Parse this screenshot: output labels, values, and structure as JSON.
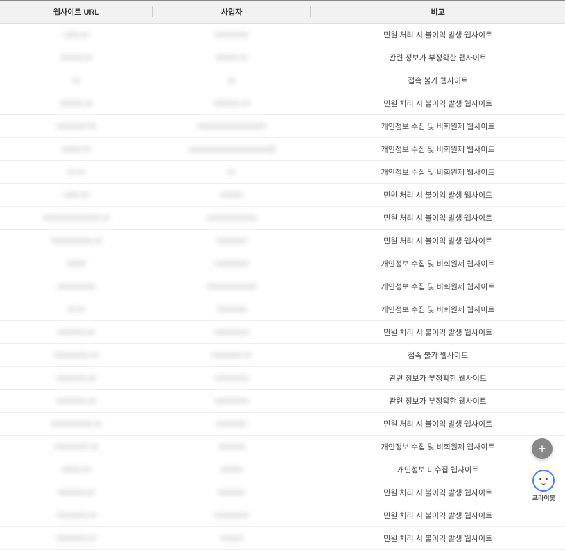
{
  "table": {
    "headers": {
      "url": "웹사이트 URL",
      "operator": "사업자",
      "remark": "비고"
    },
    "rows": [
      {
        "url": "xxxx.xx",
        "operator": "xxxxxxxxx",
        "remark": "민원 처리 시 불이익 발생 웹사이트"
      },
      {
        "url": "xxxxxx.xx",
        "operator": "xxxxxx.xx",
        "remark": "관련 정보가 부정확한 웹사이트"
      },
      {
        "url": "xx",
        "operator": "xx",
        "remark": "접속 불가 웹사이트"
      },
      {
        "url": "xxxxxx.xx",
        "operator": "xxxxxxx.xx",
        "remark": "민원 처리 시 불이익 발생 웹사이트"
      },
      {
        "url": "xxxxxxxx.xx",
        "operator": "xxxxxxxxxxxxxxxxxx",
        "remark": "개인정보 수집 및 비회원제 웹사이트"
      },
      {
        "url": "xxxxx.xx",
        "operator": "xxxxxxxxxxxxxxxxxxxxx관",
        "remark": "개인정보 수집 및 비회원제 웹사이트"
      },
      {
        "url": "xx.xx",
        "operator": "xx",
        "remark": "개인정보 수집 및 비회원제 웹사이트"
      },
      {
        "url": "xxxx.xx",
        "operator": "xxxxxx",
        "remark": "민원 처리 시 불이익 발생 웹사이트"
      },
      {
        "url": "xxxxxxxxxxxxxxx.xx",
        "operator": "xxxxxxxxxxxxx",
        "remark": "민원 처리 시 불이익 발생 웹사이트"
      },
      {
        "url": "xxxxxxxxxxx.xx",
        "operator": "xxxxxxxx",
        "remark": "민원 처리 시 불이익 발생 웹사이트"
      },
      {
        "url": "xxxxx",
        "operator": "xxxxxxxxx",
        "remark": "개인정보 수집 및 비회원제 웹사이트"
      },
      {
        "url": "xxxxxxxxxx",
        "operator": "xxxxxxxxxxxxx",
        "remark": "개인정보 수집 및 비회원제 웹사이트"
      },
      {
        "url": "xx.xx",
        "operator": "xxxxxxxx",
        "remark": "개인정보 수집 및 비회원제 웹사이트"
      },
      {
        "url": "xxxxxxx.xx",
        "operator": "xxxxxxxxx",
        "remark": "민원 처리 시 불이익 발생 웹사이트"
      },
      {
        "url": "xxxxxxxxx.xx",
        "operator": "xxxxxxxx.xx",
        "remark": "접속 불가 웹사이트"
      },
      {
        "url": "xxxxxxxx.xx",
        "operator": "xxxxxxxxx",
        "remark": "관련 정보가 부정확한 웹사이트"
      },
      {
        "url": "xxxxxxxx.xx",
        "operator": "xxxxxxxxx",
        "remark": "관련 정보가 부정확한 웹사이트"
      },
      {
        "url": "xxxxxxxxxxx.xx",
        "operator": "xxxxxxxx",
        "remark": "민원 처리 시 불이익 발생 웹사이트"
      },
      {
        "url": "xxxxxxxxx.xx",
        "operator": "xxxxxxx",
        "remark": "개인정보 수집 및 비회원제 웹사이트"
      },
      {
        "url": "xxxxx.xx",
        "operator": "xxxxxx",
        "remark": "개인정보 미수집 웹사이트"
      },
      {
        "url": "xxxxxxx.xx",
        "operator": "xxxxxxx",
        "remark": "민원 처리 시 불이익 발생 웹사이트"
      },
      {
        "url": "xxxxxxxx.xx",
        "operator": "xxxxxxxxx",
        "remark": "민원 처리 시 불이익 발생 웹사이트"
      },
      {
        "url": "xxxxxxxx.xx",
        "operator": "xxxxxx",
        "remark": "민원 처리 시 불이익 발생 웹사이트"
      }
    ]
  },
  "chat": {
    "label": "프라이봇"
  },
  "fab": {
    "label": "+"
  }
}
